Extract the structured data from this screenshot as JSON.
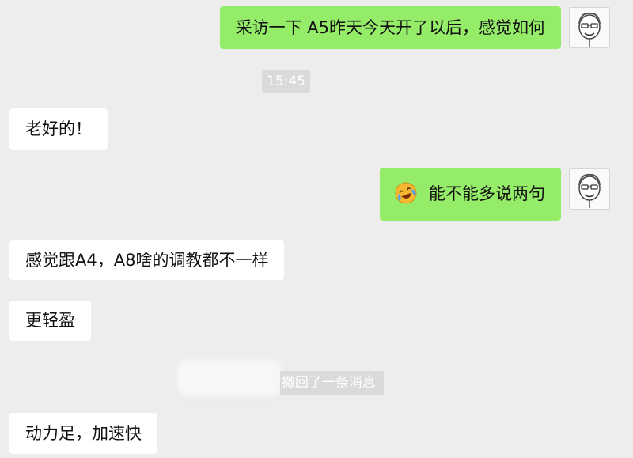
{
  "chat": {
    "messages": [
      {
        "side": "out",
        "text": "采访一下 A5昨天今天开了以后，感觉如何"
      },
      {
        "time": "15:45"
      },
      {
        "side": "in",
        "text": "老好的！"
      },
      {
        "side": "out",
        "emoji": "laughing-crying-emoji",
        "text": "能不能多说两句"
      },
      {
        "side": "in",
        "text": "感觉跟A4，A8啥的调教都不一样"
      },
      {
        "side": "in",
        "text": "更轻盈"
      },
      {
        "recall_note": "撤回了一条消息"
      },
      {
        "side": "in",
        "text": "动力足，加速快"
      }
    ]
  },
  "colors": {
    "background": "#ededed",
    "outgoing_bubble": "#95ec69",
    "incoming_bubble": "#ffffff",
    "system_text_bg": "#dadada"
  }
}
